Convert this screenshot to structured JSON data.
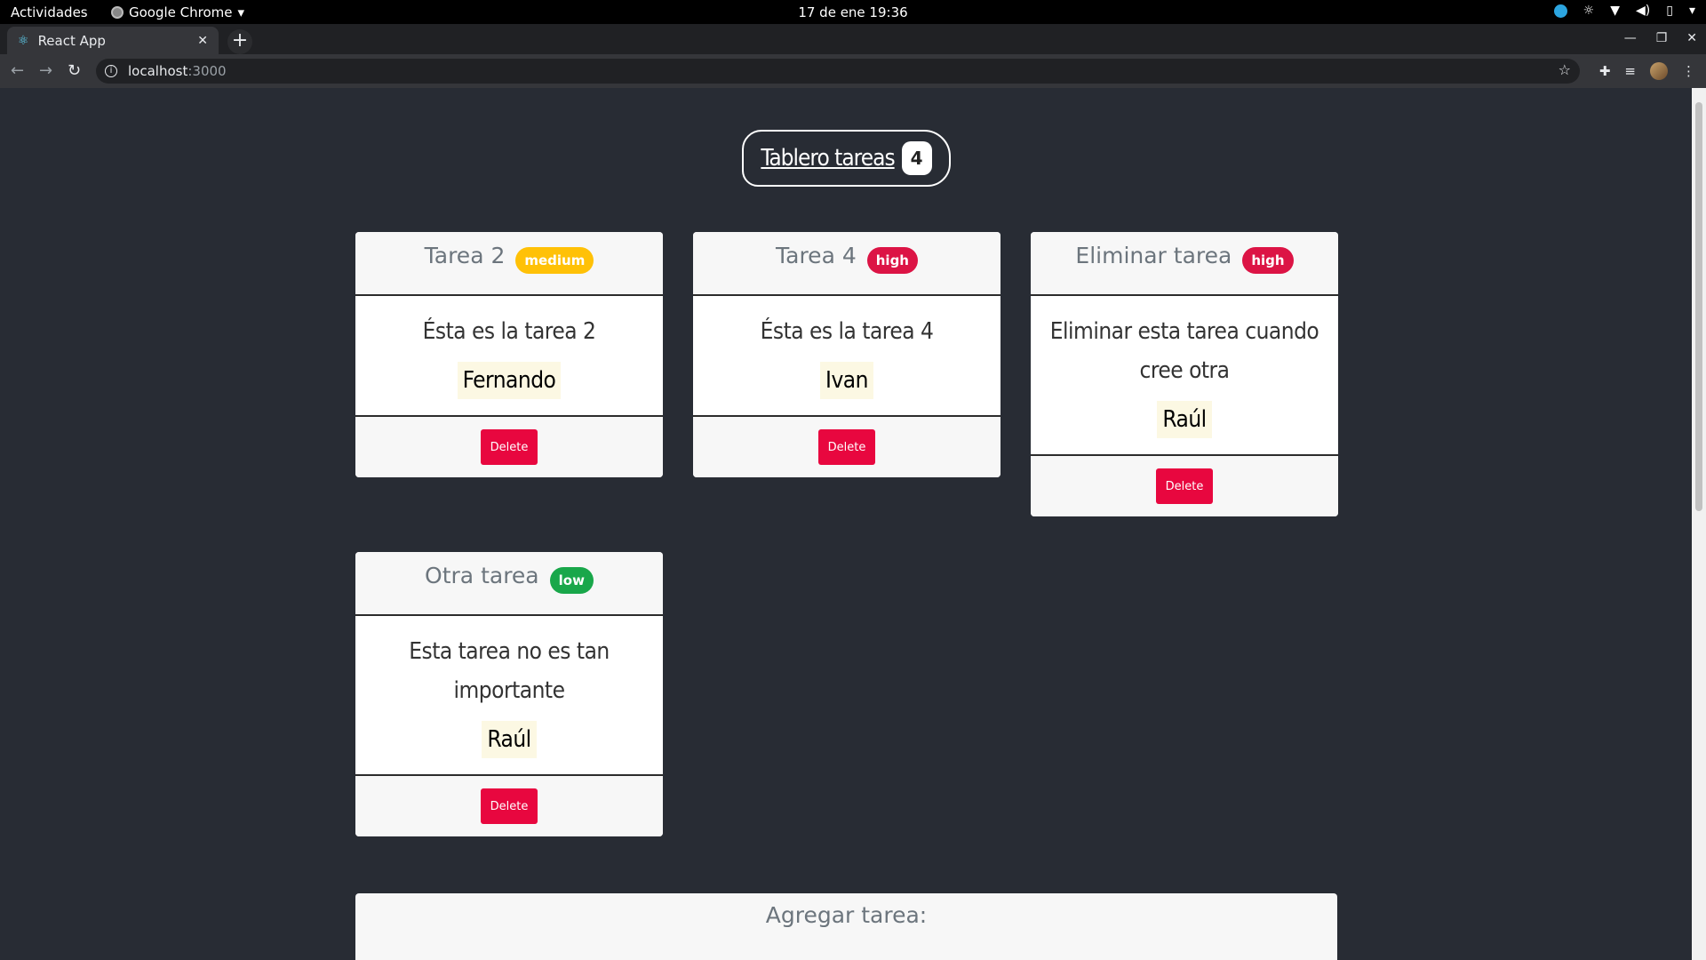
{
  "topbar": {
    "activities": "Actividades",
    "app": "Google Chrome",
    "clock": "17 de ene  19:36"
  },
  "browser": {
    "tab_title": "React App",
    "url_host": "localhost",
    "url_port": ":3000"
  },
  "board": {
    "title": "Tablero tareas",
    "count": "4"
  },
  "cards": [
    {
      "title": "Tarea 2",
      "priority": "medium",
      "description": "Ésta es la tarea 2",
      "person": "Fernando",
      "delete": "Delete"
    },
    {
      "title": "Tarea 4",
      "priority": "high",
      "description": "Ésta es la tarea 4",
      "person": "Ivan",
      "delete": "Delete"
    },
    {
      "title": "Eliminar tarea",
      "priority": "high",
      "description": "Eliminar esta tarea cuando cree otra",
      "person": "Raúl",
      "delete": "Delete"
    },
    {
      "title": "Otra tarea",
      "priority": "low",
      "description": "Esta tarea no es tan importante",
      "person": "Raúl",
      "delete": "Delete"
    }
  ],
  "form": {
    "title": "Agregar tarea:"
  },
  "colors": {
    "medium": "#ffc107",
    "high": "#dc1445",
    "low": "#19a74a",
    "delete": "#e8073f",
    "background": "#282c34"
  }
}
